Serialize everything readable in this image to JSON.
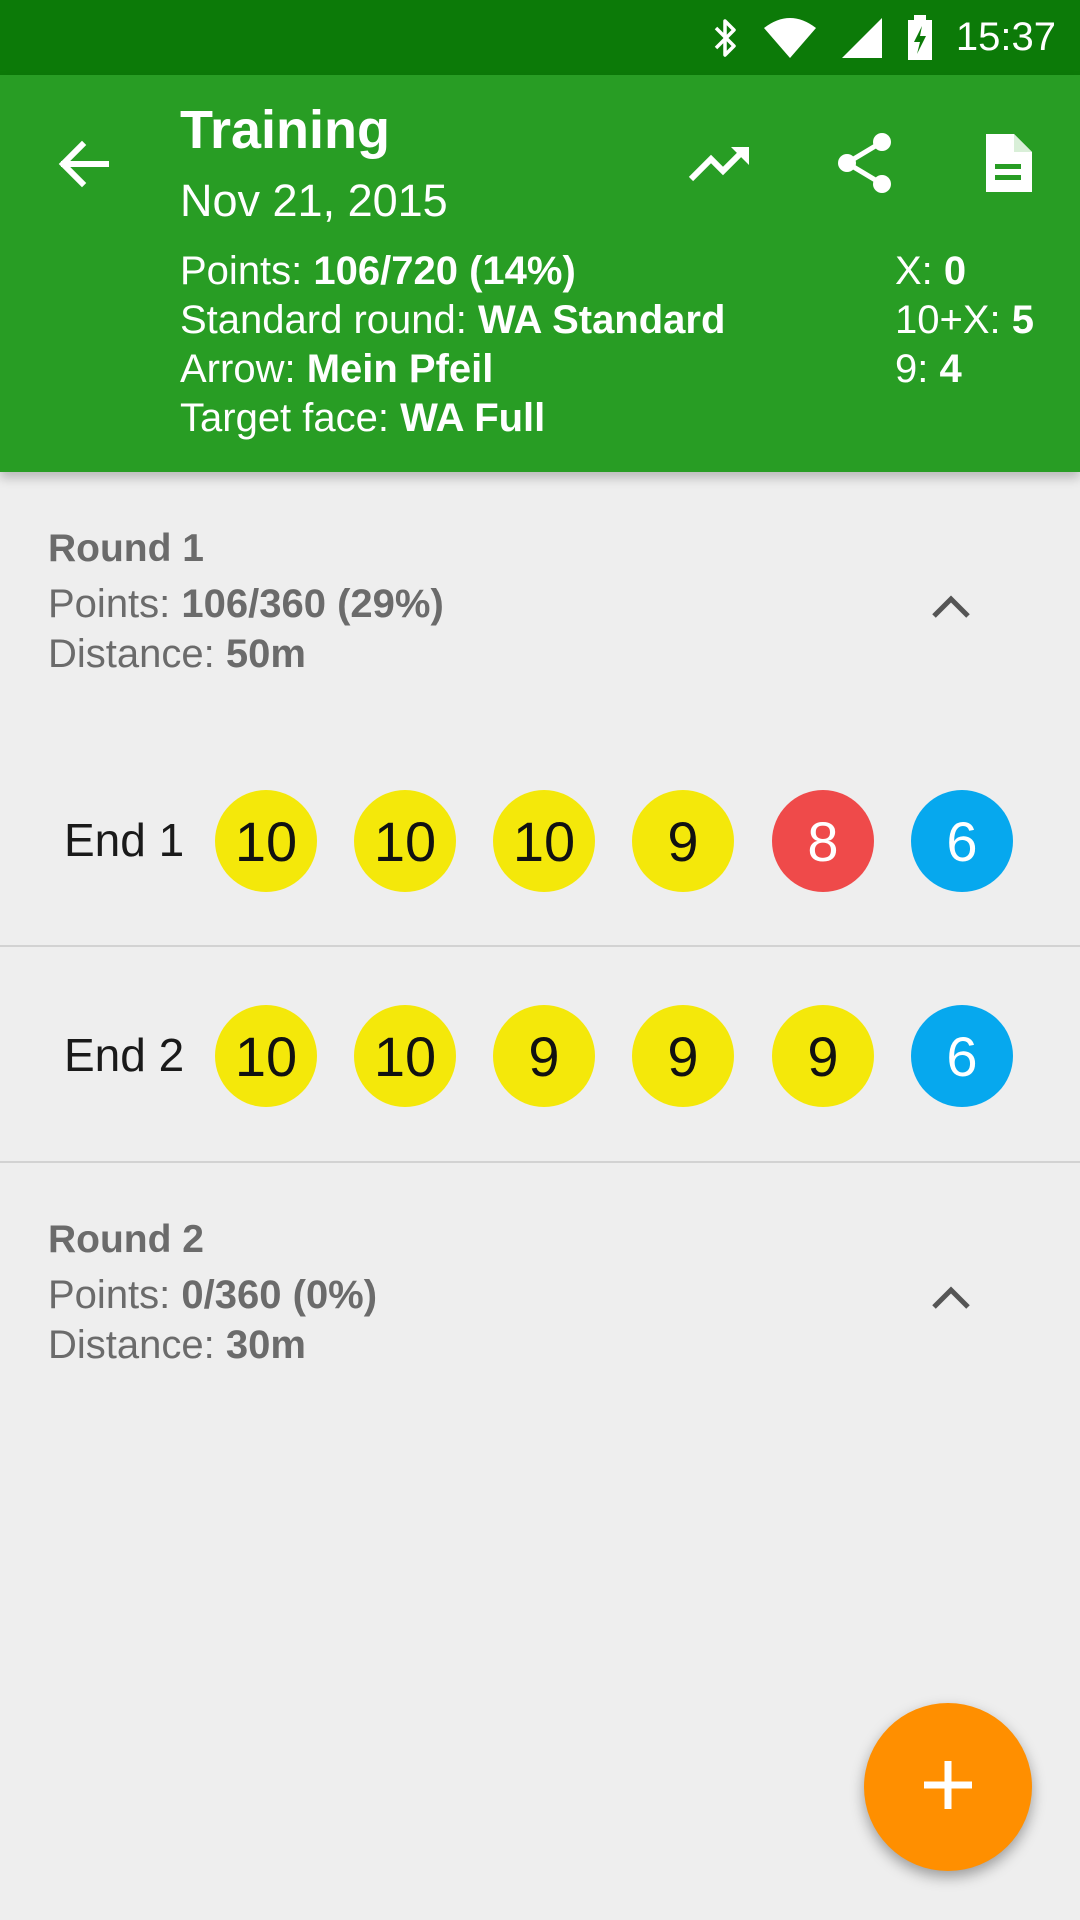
{
  "status_bar": {
    "time": "15:37",
    "icons": [
      "bluetooth-icon",
      "wifi-icon",
      "cell-signal-icon",
      "battery-charging-icon"
    ]
  },
  "header": {
    "title": "Training",
    "date": "Nov 21, 2015",
    "points_label": "Points: ",
    "points_value": "106/720 (14%)",
    "standard_round_label": "Standard round: ",
    "standard_round_value": "WA Standard",
    "arrow_label": "Arrow: ",
    "arrow_value": "Mein Pfeil",
    "target_face_label": "Target face: ",
    "target_face_value": "WA Full",
    "x_label": "X: ",
    "x_value": "0",
    "ten_x_label": "10+X: ",
    "ten_x_value": "5",
    "nine_label": "9: ",
    "nine_value": "4",
    "actions": [
      "back-arrow-icon",
      "trending-up-icon",
      "share-icon",
      "document-icon"
    ]
  },
  "rounds": [
    {
      "title": "Round 1",
      "points_label": "Points: ",
      "points_value": "106/360 (29%)",
      "distance_label": "Distance: ",
      "distance_value": "50m",
      "ends": [
        {
          "label": "End 1",
          "arrows": [
            "10",
            "10",
            "10",
            "9",
            "8",
            "6"
          ]
        },
        {
          "label": "End 2",
          "arrows": [
            "10",
            "10",
            "9",
            "9",
            "9",
            "6"
          ]
        }
      ]
    },
    {
      "title": "Round 2",
      "points_label": "Points: ",
      "points_value": "0/360 (0%)",
      "distance_label": "Distance: ",
      "distance_value": "30m",
      "ends": []
    }
  ],
  "fab": {
    "icon": "plus-icon"
  },
  "colors": {
    "status_bar": "#0c7a08",
    "header": "#289d24",
    "score_gold": "#f4e80a",
    "score_red": "#ef4a4a",
    "score_blue": "#06a8ee",
    "fab": "#ff8f00"
  }
}
